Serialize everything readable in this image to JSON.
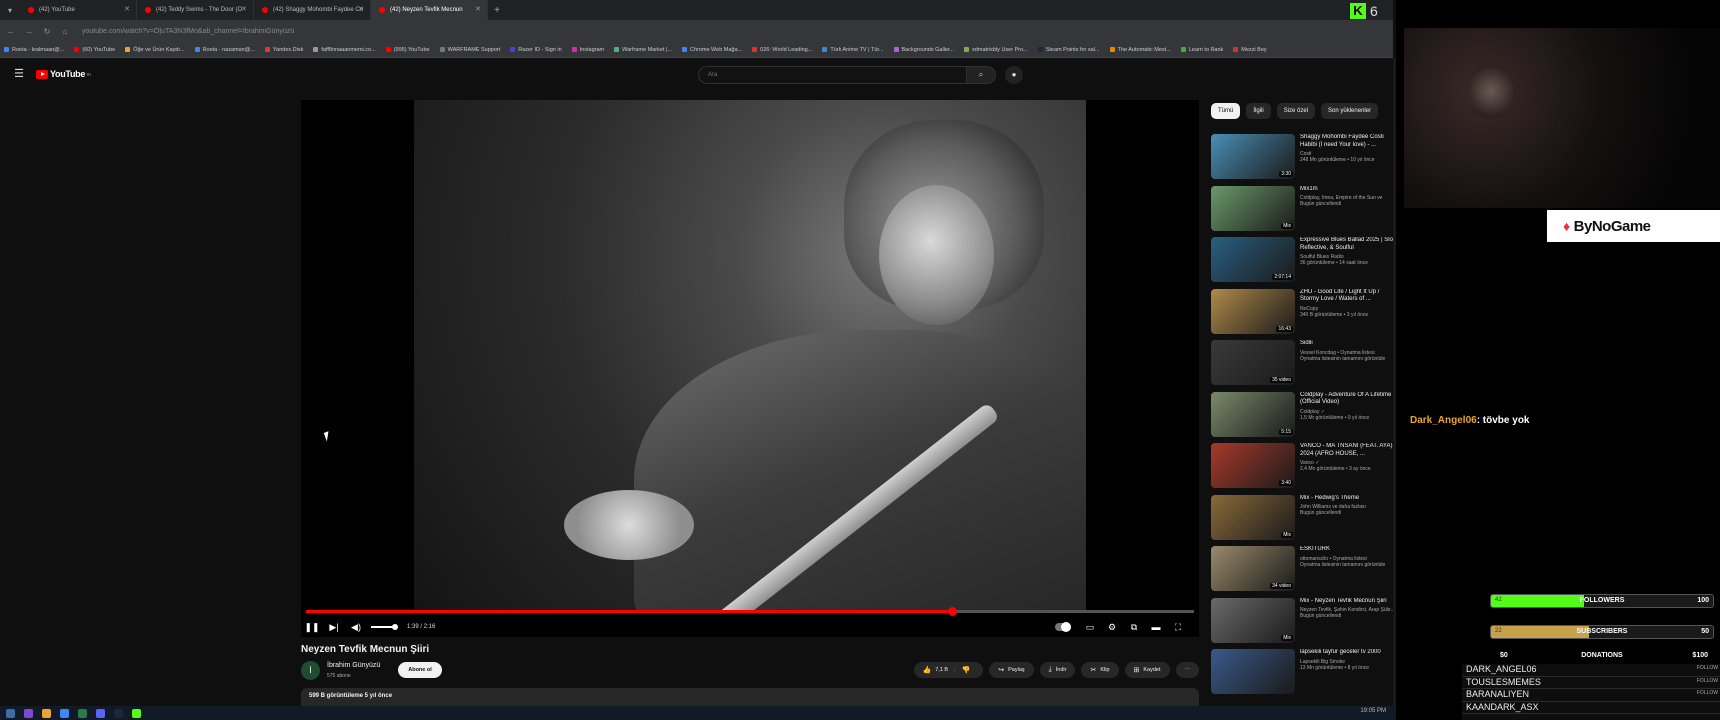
{
  "browser": {
    "tabs": [
      {
        "label": "(42) YouTube",
        "active": false
      },
      {
        "label": "(42) Teddy Swims - The Door (O",
        "active": false
      },
      {
        "label": "(42) Shaggy Mohombi Faydee Co",
        "active": false
      },
      {
        "label": "(42) Neyzen Tevfik Mecnun",
        "active": true
      }
    ],
    "url": "youtube.com/watch?v=O|uTA3N3fMo&ab_channel=İbrahimGünyüzü",
    "bookmarks": [
      "Roeta - kralmaan@...",
      "(60) YouTube",
      "Öğe ve Ürün Kaydı...",
      "Roeta - nazaman@...",
      "Yandex.Disk",
      "faff8nnaaanmemi.co...",
      "(995) YouTube",
      "WARFRAME Support",
      "Razer ID - Sign in",
      "Instagram",
      "Warframe Market |...",
      "Chrome Web Mağa...",
      "026: World Leading...",
      "Türk Anime TV | Tür...",
      "Backgrounds Galler...",
      "xdmatrixbly User Pro...",
      "Steam Points for sal...",
      "The Automatic Mest...",
      "Learn to Rank",
      "Mezzi Bey"
    ]
  },
  "youtube": {
    "logo_text": "YouTube",
    "logo_region": "TR",
    "search_placeholder": "Ara",
    "video": {
      "title": "Neyzen Tevfik Mecnun Şiiri",
      "time_current": "1:39",
      "time_total": "2:16",
      "time_display": "1:39 / 2:16",
      "progress_fraction": 0.728,
      "channel_name": "İbrahim Günyüzü",
      "channel_initial": "İ",
      "channel_subs": "575 abone",
      "subscribe_label": "Abone ol",
      "likes": "7,1 B",
      "share_label": "Paylaş",
      "download_label": "İndir",
      "clip_label": "Klip",
      "save_label": "Kaydet",
      "views_date": "599 B görüntüleme  5 yıl önce"
    },
    "chips": [
      "Tümü",
      "İlgili",
      "Size özel",
      "Son yüklenenler"
    ],
    "recommendations": [
      {
        "title": "Shaggy Mohombi Faydee Costi Habibi (I need Your love) - ...",
        "channel": "Costi",
        "meta": "248 Mn görüntüleme • 10 yıl önce",
        "duration": "3:30",
        "thumb": "#4a8fb5"
      },
      {
        "title": "Mix1m",
        "channel": "Coldplay, Imea, Empire of the Sun ve",
        "meta": "Bugün güncellendi",
        "duration": "Mix",
        "thumb": "#6a9a6a"
      },
      {
        "title": "Expressive Blues Ballad 2025 | Slow, Reflective, & Soulful",
        "channel": "Soulful Blues Radio",
        "meta": "36 görüntüleme • 14 saat önce",
        "duration": "2:07:14",
        "thumb": "#2a5f82"
      },
      {
        "title": "ZHU - Good Life / Light It Up / Stormy Love / Waters of ...",
        "channel": "NoCopy",
        "meta": "340 B görüntüleme • 3 yıl önce",
        "duration": "16:43",
        "thumb": "#b08a4a"
      },
      {
        "title": "Sidili",
        "channel": "Vessel Koncdag • Oynatma listesi",
        "meta": "Oynatma listesinin tamamını görüntüle",
        "duration": "35 video",
        "thumb": "#3a3a3a"
      },
      {
        "title": "Coldplay - Adventure Of A Lifetime (Official Video)",
        "channel": "Coldplay ✓",
        "meta": "1,5 Mr görüntüleme • 9 yıl önce",
        "duration": "5:15",
        "thumb": "#7a8a6a"
      },
      {
        "title": "VANCO - MA TNSANI (FEAT. AYA) 2024 (AFRO HOUSE, ...",
        "channel": "Vanco ✓",
        "meta": "2,4 Mn görüntüleme • 3 ay önce",
        "duration": "3:40",
        "thumb": "#a83a2a"
      },
      {
        "title": "Mix - Hedwig's Theme",
        "channel": "John Williams ve daha fazlası",
        "meta": "Bugün güncellendi",
        "duration": "Mix",
        "thumb": "#8a6a3a"
      },
      {
        "title": "ESKITURK",
        "channel": "ottomanscilo • Oynatma listesi",
        "meta": "Oynatma listesinin tamamını görüntüle",
        "duration": "34 video",
        "thumb": "#9a8a6a"
      },
      {
        "title": "Mix - Neyzen Tevfik Mecnun Şiiri",
        "channel": "Neyzen Tevfik, Şahin Kendirci, Arap Şükr...",
        "meta": "Bugün güncellendi",
        "duration": "Mix",
        "thumb": "#6a6a6a"
      },
      {
        "title": "lapsekili tayfur geceler tv 2000",
        "channel": "Lapsekili Big Smoke",
        "meta": "13 Mn görüntüleme • 8 yıl önce",
        "duration": "",
        "thumb": "#3a5a8a"
      }
    ]
  },
  "stream_overlay": {
    "kick_logo": "K",
    "viewer_count": "6",
    "brand": "ByNoGame",
    "chat": {
      "user": "Dark_Angel06",
      "message": ": tövbe yok"
    },
    "goals": [
      {
        "label": "FOLLOWERS",
        "current": "42",
        "max": "100",
        "fraction": 0.42,
        "color": "#53fc18"
      },
      {
        "label": "SUBSCRIBERS",
        "current": "22",
        "max": "50",
        "fraction": 0.44,
        "color": "#c8a24a"
      }
    ],
    "donations": {
      "label": "DONATIONS",
      "min": "$0",
      "max": "$100"
    },
    "events": [
      {
        "name": "DARK_ANGEL06",
        "tag": "FOLLOW"
      },
      {
        "name": "TOUSLESMEMES",
        "tag": "FOLLOW"
      },
      {
        "name": "BARANALIYEN",
        "tag": "FOLLOW"
      },
      {
        "name": "KAANDARK_ASX",
        "tag": ""
      }
    ]
  },
  "taskbar": {
    "clock": "19:05 PM"
  },
  "colors": {
    "accent": "#ff0000",
    "kick": "#53fc18",
    "chat_user": "#e8a532"
  }
}
